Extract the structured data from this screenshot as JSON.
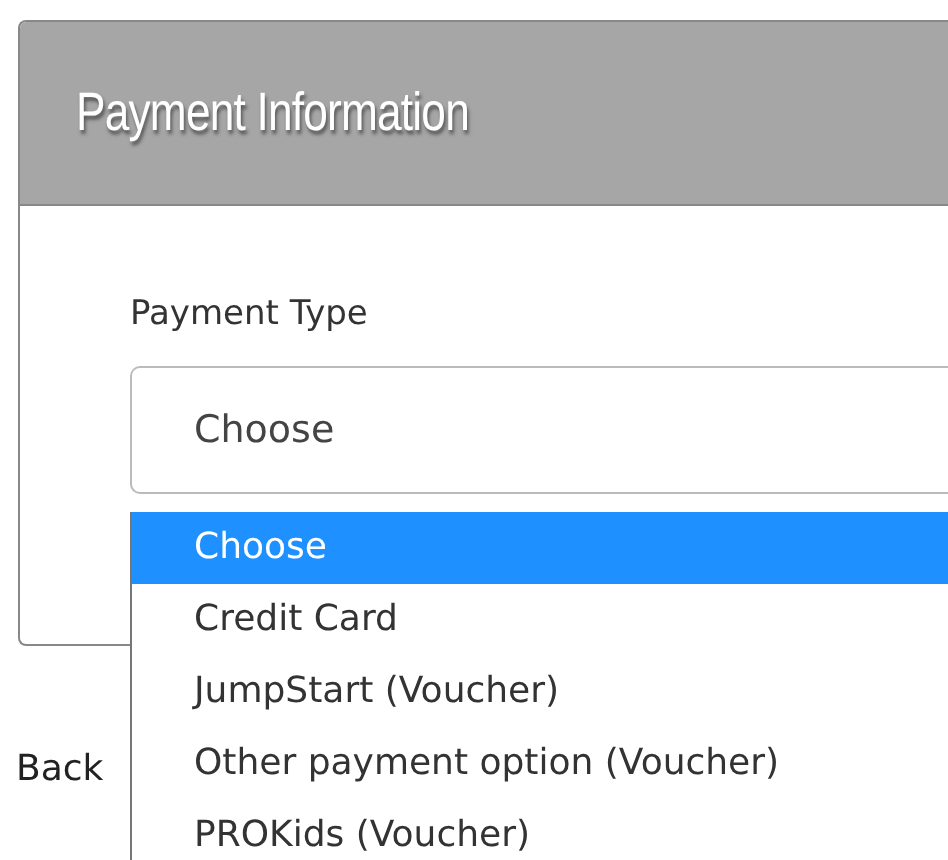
{
  "panel": {
    "title": "Payment Information"
  },
  "field": {
    "label": "Payment Type",
    "value": "Choose"
  },
  "dropdown": {
    "expanded": true,
    "options": [
      {
        "label": "Choose",
        "selected": true
      },
      {
        "label": "Credit Card",
        "selected": false
      },
      {
        "label": "JumpStart (Voucher)",
        "selected": false
      },
      {
        "label": "Other payment option (Voucher)",
        "selected": false
      },
      {
        "label": "PROKids (Voucher)",
        "selected": false
      }
    ]
  },
  "back_link": "Back"
}
